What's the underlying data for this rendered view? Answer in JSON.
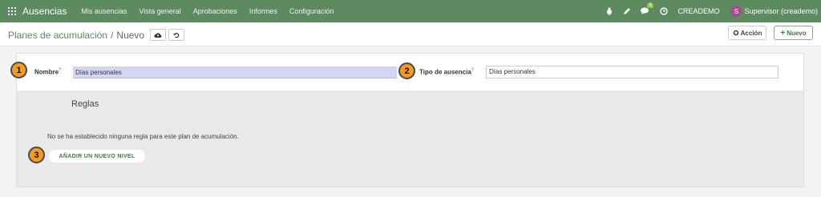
{
  "navbar": {
    "app_title": "Ausencias",
    "menu": [
      "Mis ausencias",
      "Vista general",
      "Aprobaciones",
      "Informes",
      "Configuración"
    ],
    "messages_badge": "5",
    "company": "CREADEMO",
    "avatar_initial": "S",
    "user": "Supervisor (creademo)"
  },
  "control_panel": {
    "breadcrumb_parent": "Planes de acumulación",
    "breadcrumb_sep": "/",
    "breadcrumb_current": "Nuevo",
    "accion_label": "Acción",
    "nuevo_label": "Nuevo"
  },
  "form": {
    "nombre_label": "Nombre",
    "nombre_value": "Días personales",
    "tipo_label": "Tipo de ausencia",
    "tipo_value": "Días personales",
    "help_mark": "?",
    "rules_title": "Reglas",
    "empty_message": "No se ha establecido ninguna regla para este plan de acumulación.",
    "add_level_label": "AÑADIR UN NUEVO NIVEL"
  },
  "callouts": [
    "1",
    "2",
    "3"
  ],
  "colors": {
    "navbar": "#5d8a5f",
    "accent": "#3e7b45",
    "callout": "#f59b21",
    "input_highlight": "#d5d6f5"
  }
}
